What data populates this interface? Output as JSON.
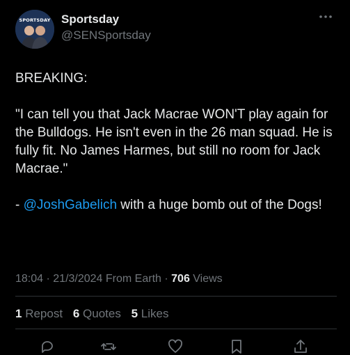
{
  "author": {
    "avatar_brand": "SPORTSDAY",
    "display_name": "Sportsday",
    "handle": "@SENSportsday"
  },
  "tweet": {
    "line_breaking": "BREAKING:",
    "quote": "\"I can tell you that Jack Macrae WON'T play again for the Bulldogs. He isn't even in the 26 man squad. He is fully fit. No James Harmes, but still no room for Jack Macrae.\"",
    "attribution_prefix": "- ",
    "mention": "@JoshGabelich",
    "attribution_suffix": " with a huge bomb out of the Dogs!"
  },
  "meta": {
    "time": "18:04",
    "sep1": " · ",
    "date": "21/3/2024",
    "source": " From Earth",
    "sep2": " · ",
    "views_count": "706",
    "views_label": " Views"
  },
  "stats": {
    "reposts_count": "1",
    "reposts_label": "Repost",
    "quotes_count": "6",
    "quotes_label": "Quotes",
    "likes_count": "5",
    "likes_label": "Likes"
  },
  "icons": {
    "more": "more-horizontal-icon",
    "reply": "reply-icon",
    "repost": "repost-icon",
    "like": "heart-icon",
    "bookmark": "bookmark-icon",
    "share": "share-icon"
  },
  "colors": {
    "background": "#000000",
    "text": "#e7e9ea",
    "secondary": "#71767b",
    "link": "#1d9bf0"
  }
}
